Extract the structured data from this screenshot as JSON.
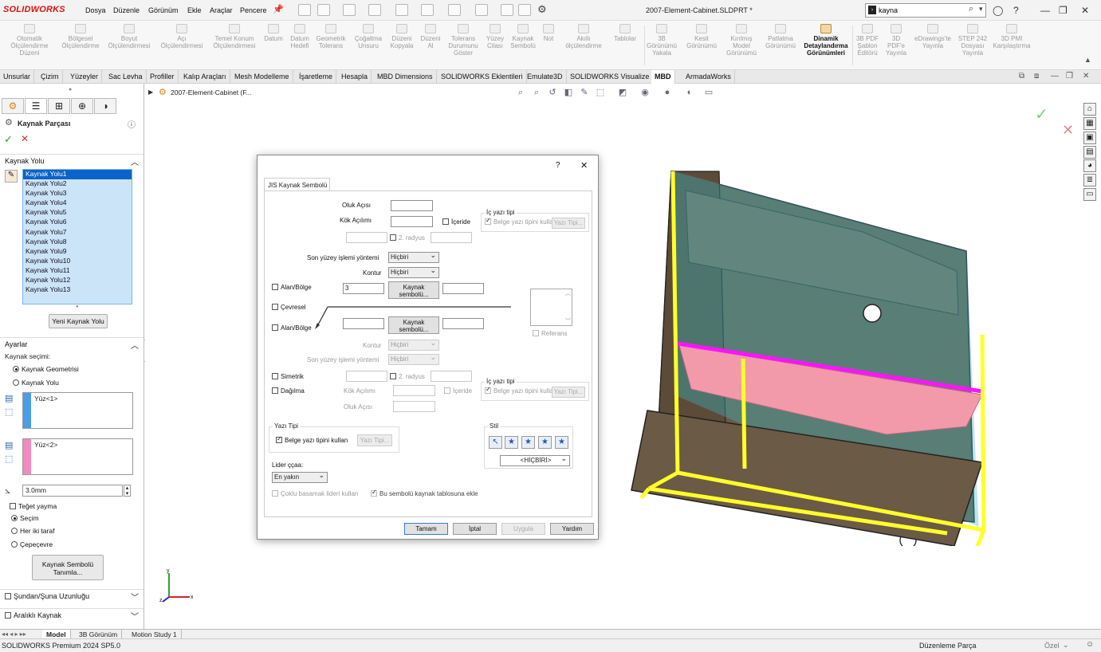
{
  "app": {
    "logo": "SOLIDWORKS",
    "doc_title": "2007-Element-Cabinet.SLDPRT *"
  },
  "menu": [
    "Dosya",
    "Düzenle",
    "Görünüm",
    "Ekle",
    "Araçlar",
    "Pencere"
  ],
  "search": {
    "value": "kayna",
    "placeholder": ""
  },
  "ribbon": [
    {
      "label": "Otomatik Ölçülendirme Düzeni"
    },
    {
      "label": "Bölgesel Ölçülendirme"
    },
    {
      "label": "Boyut Ölçülendirmesi"
    },
    {
      "label": "Açı Ölçülendirmesi"
    },
    {
      "label": "Temel Konum Ölçülendirmesi"
    },
    {
      "label": "Datum"
    },
    {
      "label": "Datum Hedefi"
    },
    {
      "label": "Geometrik Tolerans"
    },
    {
      "label": "Çoğaltma Unsuru"
    },
    {
      "label": "Düzeni Kopyala"
    },
    {
      "label": "Düzeni Al"
    },
    {
      "label": "Tolerans Durumunu Göster"
    },
    {
      "label": "Yüzey Cilası"
    },
    {
      "label": "Kaynak Sembolü"
    },
    {
      "label": "Not"
    },
    {
      "label": "Akıllı ölçülendirme"
    },
    {
      "label": "Tablolar"
    },
    {
      "label": "3B Görünümü Yakala"
    },
    {
      "label": "Kesit Görünümü"
    },
    {
      "label": "Kırılmış Model Görünümü"
    },
    {
      "label": "Patlatma Görünümü"
    },
    {
      "label": "Dinamik Detaylandırma Görünümleri"
    },
    {
      "label": "3B PDF Şablon Editörü"
    },
    {
      "label": "3D PDF'e Yayınla"
    },
    {
      "label": "eDrawings'te Yayınla"
    },
    {
      "label": "STEP 242 Dosyası Yayınla"
    },
    {
      "label": "3D PMI Karşılaştırma"
    }
  ],
  "tabs": [
    "Unsurlar",
    "Çizim",
    "Yüzeyler",
    "Sac Levha",
    "Profiller",
    "Kalıp Araçları",
    "Mesh Modelleme",
    "İşaretleme",
    "Hesapla",
    "MBD Dimensions",
    "SOLIDWORKS Eklentileri",
    "Emulate3D",
    "SOLIDWORKS Visualize",
    "MBD",
    "ArmadaWorks"
  ],
  "panel": {
    "title": "Kaynak Parçası",
    "weld_path_section": "Kaynak Yolu",
    "weld_paths": [
      "Kaynak Yolu1",
      "Kaynak Yolu2",
      "Kaynak Yolu3",
      "Kaynak Yolu4",
      "Kaynak Yolu5",
      "Kaynak Yolu6",
      "Kaynak Yolu7",
      "Kaynak Yolu8",
      "Kaynak Yolu9",
      "Kaynak Yolu10",
      "Kaynak Yolu11",
      "Kaynak Yolu12",
      "Kaynak Yolu13"
    ],
    "new_path_button": "Yeni Kaynak Yolu",
    "settings_section": "Ayarlar",
    "selection_label": "Kaynak seçimi:",
    "opt_geometry": "Kaynak Geometrisi",
    "opt_path": "Kaynak Yolu",
    "face1": "Yüz<1>",
    "face2": "Yüz<2>",
    "size": "3.0mm",
    "tangent": "Teğet yayma",
    "sel": "Seçim",
    "both": "Her iki taraf",
    "around": "Çepeçevre",
    "symbol_button": "Kaynak Sembolü Tanımla...",
    "from_to": "Şundan/Şuna Uzunluğu",
    "intermittent": "Aralıklı Kaynak"
  },
  "tree": {
    "root": "2007-Element-Cabinet (F..."
  },
  "dialog": {
    "tab": "JIS Kaynak Sembolü",
    "groove_angle": "Oluk Açısı",
    "root_gap": "Kök Açılımı",
    "inside": "İçeride",
    "radius2": "2. radyus",
    "finish_method": "Son yüzey işlemi yöntemi",
    "finish_value": "Hiçbiri",
    "contour": "Kontur",
    "contour_value": "Hiçbiri",
    "field_area": "Alan/Bölge",
    "field_value": "3",
    "weld_symbol_btn": "Kaynak sembolü...",
    "circumferential": "Çevresel",
    "field_area2": "Alan/Bölge",
    "contour2": "Kontur",
    "contour2_value": "Hiçbiri",
    "finish_method2": "Son yüzey işlemi yöntemi",
    "finish2_value": "Hiçbiri",
    "symmetric": "Simetrik",
    "staggered": "Dağılma",
    "radius2b": "2. radyus",
    "root_gap2": "Kök Açılımı",
    "inside2": "İçeride",
    "groove_angle2": "Oluk Açısı",
    "font_group": "İç yazı tipi",
    "use_doc_font": "Belge yazı tipini kullan",
    "font_btn": "Yazı Tipi...",
    "reference": "Referans",
    "font_section": "Yazı Tipi",
    "use_doc_font2": "Belge yazı tipini kullan",
    "font_btn2": "Yazı Tipi...",
    "style": "Stil",
    "style_value": "<HİÇBİRİ>",
    "leader": "Lider ççaa:",
    "leader_value": "En yakın",
    "multi_jog": "Çoklu basamak lideri kullan",
    "add_to_table": "Bu sembolü kaynak tablosuna ekle",
    "ok": "Tamam",
    "cancel": "İptal",
    "apply": "Uygula",
    "help": "Yardım",
    "help_q": "?",
    "close": "✕"
  },
  "bottom_tabs": [
    "Model",
    "3B Görünüm",
    "Motion Study 1"
  ],
  "status": {
    "left": "SOLIDWORKS Premium 2024 SP5.0",
    "mode": "Düzenleme Parça",
    "units": "Özel"
  },
  "colors": {
    "weld_highlight": "#ffff2a",
    "face1": "#4a9de8",
    "face2": "#f48ac0",
    "shelf_pink": "#f39aaa",
    "edge_magenta": "#ff14ff",
    "wood": "#6b5a45"
  }
}
